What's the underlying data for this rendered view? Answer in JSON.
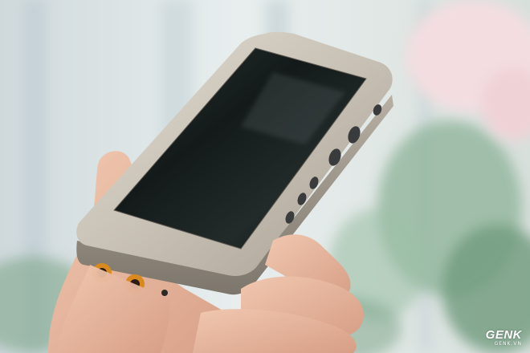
{
  "watermark": {
    "brand": "GENK",
    "site": "GENK.VN"
  },
  "device": {
    "description_icon": "digital-audio-player",
    "body_color": "#c9c2b6",
    "screen_color": "#141a1a",
    "jack_color": "#d98a1e",
    "button_color": "#3a3b3c"
  },
  "scene_colors": {
    "background": "#dfe6e8",
    "foliage": "#7fa58a",
    "flower": "#f3dde0",
    "skin": "#e9b9a0"
  }
}
